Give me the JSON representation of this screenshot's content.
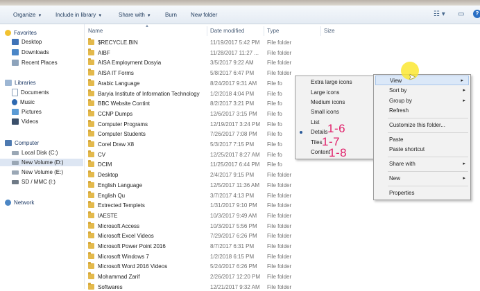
{
  "toolbar": {
    "organize": "Organize",
    "include": "Include in library",
    "share": "Share with",
    "burn": "Burn",
    "new_folder": "New folder"
  },
  "nav": {
    "favorites": "Favorites",
    "desktop": "Desktop",
    "downloads": "Downloads",
    "recent": "Recent Places",
    "libraries": "Libraries",
    "documents": "Documents",
    "music": "Music",
    "pictures": "Pictures",
    "videos": "Videos",
    "computer": "Computer",
    "local_c": "Local Disk (C:)",
    "vol_d": "New Volume (D:)",
    "vol_e": "New Volume (E:)",
    "sd": "SD / MMC (I:)",
    "network": "Network"
  },
  "columns": {
    "name": "Name",
    "date": "Date modified",
    "type": "Type",
    "size": "Size"
  },
  "files": [
    {
      "name": "$RECYCLE.BIN",
      "date": "11/19/2017 5:42 PM",
      "type": "File folder"
    },
    {
      "name": "AIBF",
      "date": "11/28/2017 11:27 ...",
      "type": "File folder"
    },
    {
      "name": "AISA Employment Dosyia",
      "date": "3/5/2017 9:22 AM",
      "type": "File folder"
    },
    {
      "name": "AISA IT Forms",
      "date": "5/8/2017 6:47 PM",
      "type": "File folder"
    },
    {
      "name": "Arabic Language",
      "date": "8/24/2017 9:31 AM",
      "type": "File fo"
    },
    {
      "name": "Baryia Institute of Information Technology",
      "date": "1/2/2018 4:04 PM",
      "type": "File fo"
    },
    {
      "name": "BBC Website Contint",
      "date": "8/2/2017 3:21 PM",
      "type": "File fo"
    },
    {
      "name": "CCNP Dumps",
      "date": "12/6/2017 3:15 PM",
      "type": "File fo"
    },
    {
      "name": "Computer Programs",
      "date": "12/19/2017 3:24 PM",
      "type": "File fo"
    },
    {
      "name": "Computer Students",
      "date": "7/26/2017 7:08 PM",
      "type": "File fo"
    },
    {
      "name": "Corel Draw X8",
      "date": "5/3/2017 7:15 PM",
      "type": "File fo"
    },
    {
      "name": "CV",
      "date": "12/25/2017 8:27 AM",
      "type": "File fo"
    },
    {
      "name": "DCIM",
      "date": "11/25/2017 6:44 PM",
      "type": "File fo"
    },
    {
      "name": "Desktop",
      "date": "2/4/2017 9:15 PM",
      "type": "File folder"
    },
    {
      "name": "English Language",
      "date": "12/5/2017 11:36 AM",
      "type": "File folder"
    },
    {
      "name": "English Qu",
      "date": "3/7/2017 4:13 PM",
      "type": "File folder"
    },
    {
      "name": "Extrected Templets",
      "date": "1/31/2017 9:10 PM",
      "type": "File folder"
    },
    {
      "name": "IAESTE",
      "date": "10/3/2017 9:49 AM",
      "type": "File folder"
    },
    {
      "name": "Microsoft Access",
      "date": "10/3/2017 5:56 PM",
      "type": "File folder"
    },
    {
      "name": "Microsoft Excel Videos",
      "date": "7/29/2017 6:26 PM",
      "type": "File folder"
    },
    {
      "name": "Microsoft Power Point 2016",
      "date": "8/7/2017 6:31 PM",
      "type": "File folder"
    },
    {
      "name": "Microsoft Windows 7",
      "date": "1/2/2018 6:15 PM",
      "type": "File folder"
    },
    {
      "name": "Microsoft Word 2016 Videos",
      "date": "5/24/2017 6:26 PM",
      "type": "File folder"
    },
    {
      "name": "Mohammad Zarif",
      "date": "2/26/2017 12:20 PM",
      "type": "File folder"
    },
    {
      "name": "Softwares",
      "date": "12/21/2017 9:32 AM",
      "type": "File folder"
    }
  ],
  "view_submenu": {
    "extra_large": "Extra large icons",
    "large": "Large icons",
    "medium": "Medium icons",
    "small": "Small icons",
    "list": "List",
    "details": "Details",
    "tiles": "Tiles",
    "content": "Content"
  },
  "context_menu": {
    "view": "View",
    "sort_by": "Sort by",
    "group_by": "Group by",
    "refresh": "Refresh",
    "customize": "Customize this folder...",
    "paste": "Paste",
    "paste_shortcut": "Paste shortcut",
    "share_with": "Share with",
    "new": "New",
    "properties": "Properties"
  },
  "annotations": {
    "details": "1-6",
    "tiles": "1-7",
    "content": "1-8"
  },
  "colors": {
    "accent": "#2a6fc4",
    "annotation": "#e0206a",
    "highlight": "#dbe8f8",
    "cursor_halo": "#fce832"
  }
}
